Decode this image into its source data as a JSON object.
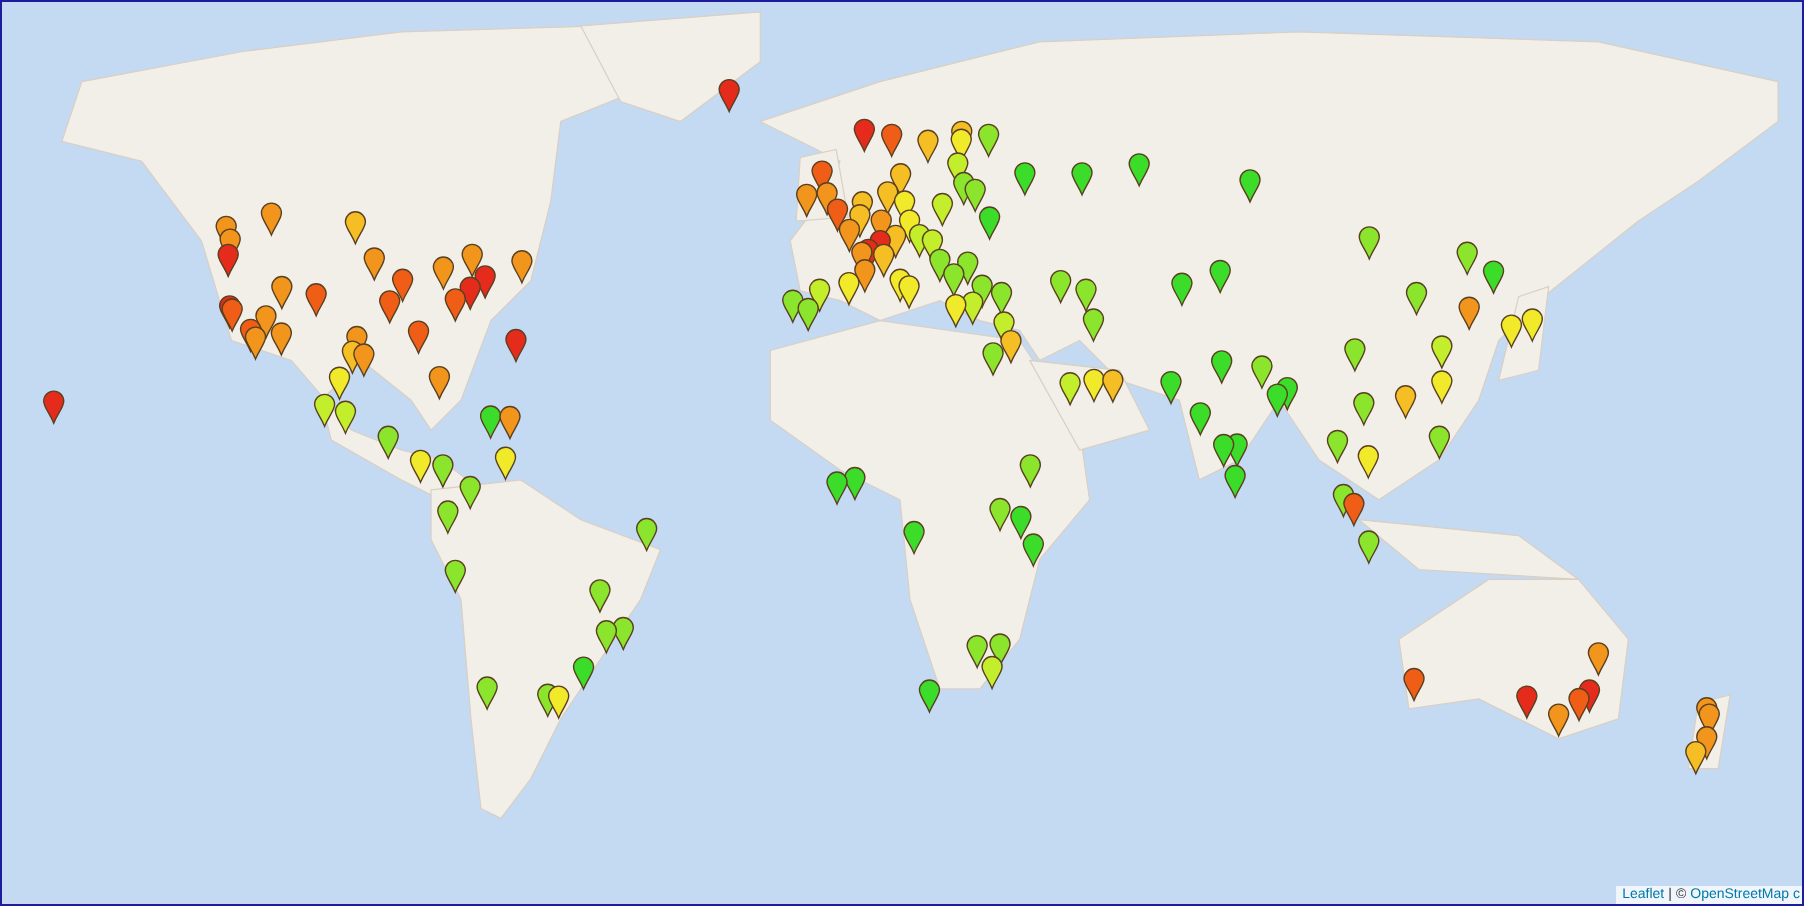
{
  "markers": [
    {
      "color": "#f2951d"
    },
    {
      "color": "#e52b1c"
    },
    {
      "color": "#e52b1c"
    },
    {
      "color": "#ef5d17"
    },
    {
      "color": "#ef5d17"
    },
    {
      "color": "#f2951d"
    },
    {
      "color": "#f2951d"
    },
    {
      "color": "#f2951d"
    },
    {
      "color": "#f2951d"
    },
    {
      "color": "#ef5d17"
    },
    {
      "color": "#f2951d"
    },
    {
      "color": "#f2951d"
    },
    {
      "color": "#f5be24"
    },
    {
      "color": "#ef5d17"
    },
    {
      "color": "#f2951d"
    },
    {
      "color": "#ef5d17"
    },
    {
      "color": "#ef5d17"
    },
    {
      "color": "#f2951d"
    },
    {
      "color": "#ef5d17"
    },
    {
      "color": "#e52b1c"
    },
    {
      "color": "#e52b1c"
    },
    {
      "color": "#f2951d"
    },
    {
      "color": "#f2951d"
    },
    {
      "color": "#f2951d"
    },
    {
      "color": "#f2951d"
    },
    {
      "color": "#f5be24"
    },
    {
      "color": "#f2951d"
    },
    {
      "color": "#e52b1c"
    },
    {
      "color": "#e52b1c"
    },
    {
      "color": "#c2ee2c"
    },
    {
      "color": "#f0ea2b"
    },
    {
      "color": "#c2ee2c"
    },
    {
      "color": "#8be52c"
    },
    {
      "color": "#f0ea2b"
    },
    {
      "color": "#8be52c"
    },
    {
      "color": "#f2951d"
    },
    {
      "color": "#3cdc2a"
    },
    {
      "color": "#8be52c"
    },
    {
      "color": "#f0ea2b"
    },
    {
      "color": "#8be52c"
    },
    {
      "color": "#8be52c"
    },
    {
      "color": "#8be52c"
    },
    {
      "color": "#8be52c"
    },
    {
      "color": "#f0ea2b"
    },
    {
      "color": "#8be52c"
    },
    {
      "color": "#8be52c"
    },
    {
      "color": "#8be52c"
    },
    {
      "color": "#8be52c"
    },
    {
      "color": "#3cdc2a"
    },
    {
      "color": "#e52b1c"
    },
    {
      "color": "#f2951d"
    },
    {
      "color": "#ef5d17"
    },
    {
      "color": "#f2951d"
    },
    {
      "color": "#ef5d17"
    },
    {
      "color": "#f2951d"
    },
    {
      "color": "#f2951d"
    },
    {
      "color": "#f2951d"
    },
    {
      "color": "#c2ee2c"
    },
    {
      "color": "#f0ea2b"
    },
    {
      "color": "#8be52c"
    },
    {
      "color": "#8be52c"
    },
    {
      "color": "#f5be24"
    },
    {
      "color": "#f5be24"
    },
    {
      "color": "#f2951d"
    },
    {
      "color": "#e52b1c"
    },
    {
      "color": "#e52b1c"
    },
    {
      "color": "#f5be24"
    },
    {
      "color": "#f0ea2b"
    },
    {
      "color": "#f5be24"
    },
    {
      "color": "#f5be24"
    },
    {
      "color": "#ef5d17"
    },
    {
      "color": "#e52b1c"
    },
    {
      "color": "#f5be24"
    },
    {
      "color": "#f5be24"
    },
    {
      "color": "#f0ea2b"
    },
    {
      "color": "#c2ee2c"
    },
    {
      "color": "#8be52c"
    },
    {
      "color": "#c2ee2c"
    },
    {
      "color": "#f0ea2b"
    },
    {
      "color": "#c2ee2c"
    },
    {
      "color": "#c2ee2c"
    },
    {
      "color": "#f5be24"
    },
    {
      "color": "#f0ea2b"
    },
    {
      "color": "#f0ea2b"
    },
    {
      "color": "#f0ea2b"
    },
    {
      "color": "#8be52c"
    },
    {
      "color": "#8be52c"
    },
    {
      "color": "#8be52c"
    },
    {
      "color": "#3cdc2a"
    },
    {
      "color": "#8be52c"
    },
    {
      "color": "#3cdc2a"
    },
    {
      "color": "#8be52c"
    },
    {
      "color": "#8be52c"
    },
    {
      "color": "#8be52c"
    },
    {
      "color": "#c2ee2c"
    },
    {
      "color": "#3cdc2a"
    },
    {
      "color": "#3cdc2a"
    },
    {
      "color": "#3cdc2a"
    },
    {
      "color": "#3cdc2a"
    },
    {
      "color": "#3cdc2a"
    },
    {
      "color": "#8be52c"
    },
    {
      "color": "#8be52c"
    },
    {
      "color": "#8be52c"
    },
    {
      "color": "#f5be24"
    },
    {
      "color": "#c2ee2c"
    },
    {
      "color": "#8be52c"
    },
    {
      "color": "#c2ee2c"
    },
    {
      "color": "#f5be24"
    },
    {
      "color": "#f0ea2b"
    },
    {
      "color": "#3cdc2a"
    },
    {
      "color": "#3cdc2a"
    },
    {
      "color": "#3cdc2a"
    },
    {
      "color": "#3cdc2a"
    },
    {
      "color": "#3cdc2a"
    },
    {
      "color": "#3cdc2a"
    },
    {
      "color": "#3cdc2a"
    },
    {
      "color": "#3cdc2a"
    },
    {
      "color": "#8be52c"
    },
    {
      "color": "#8be52c"
    },
    {
      "color": "#8be52c"
    },
    {
      "color": "#f0ea2b"
    },
    {
      "color": "#8be52c"
    },
    {
      "color": "#ef5d17"
    },
    {
      "color": "#8be52c"
    },
    {
      "color": "#8be52c"
    },
    {
      "color": "#f5be24"
    },
    {
      "color": "#f0ea2b"
    },
    {
      "color": "#c2ee2c"
    },
    {
      "color": "#8be52c"
    },
    {
      "color": "#8be52c"
    },
    {
      "color": "#f2951d"
    },
    {
      "color": "#f0ea2b"
    },
    {
      "color": "#f0ea2b"
    },
    {
      "color": "#8be52c"
    },
    {
      "color": "#3cdc2a"
    },
    {
      "color": "#8be52c"
    },
    {
      "color": "#3cdc2a"
    },
    {
      "color": "#3cdc2a"
    },
    {
      "color": "#3cdc2a"
    },
    {
      "color": "#8be52c"
    },
    {
      "color": "#3cdc2a"
    },
    {
      "color": "#3cdc2a"
    },
    {
      "color": "#8be52c"
    },
    {
      "color": "#3cdc2a"
    },
    {
      "color": "#c2ee2c"
    },
    {
      "color": "#8be52c"
    },
    {
      "color": "#8be52c"
    },
    {
      "color": "#ef5d17"
    },
    {
      "color": "#e52b1c"
    },
    {
      "color": "#f2951d"
    },
    {
      "color": "#e52b1c"
    },
    {
      "color": "#ef5d17"
    },
    {
      "color": "#f2951d"
    },
    {
      "color": "#f2951d"
    },
    {
      "color": "#f2951d"
    },
    {
      "color": "#f5be24"
    },
    {
      "color": "#f2951d"
    }
  ],
  "attribution": [
    {
      "kind": "link",
      "text": "Leaflet"
    },
    {
      "kind": "text",
      "text": "|"
    },
    {
      "kind": "text",
      "text": "©"
    },
    {
      "kind": "link",
      "text": "OpenStreetMap c"
    }
  ]
}
